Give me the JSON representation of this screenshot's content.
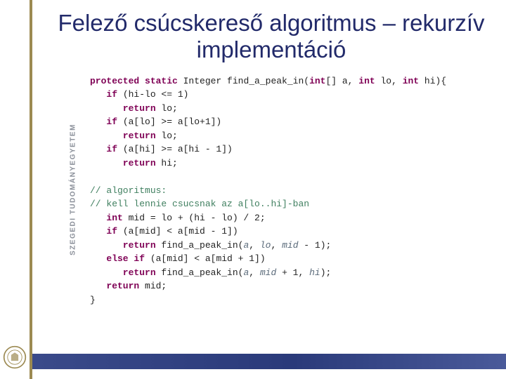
{
  "sidebar": {
    "institution": "SZEGEDI TUDOMÁNYEGYETEM",
    "logo_letters_top": "UNIVERSITAS",
    "logo_letters_bottom": "SCIENTIARUM"
  },
  "title": "Felező csúcskereső algoritmus – rekurzív implementáció",
  "code": {
    "l01a": "protected static ",
    "l01b": "Integer find_a_peak_in(",
    "l01c": "int",
    "l01d": "[] a, ",
    "l01e": "int",
    "l01f": " lo, ",
    "l01g": "int",
    "l01h": " hi){",
    "l02a": "   if ",
    "l02b": "(hi-lo <= 1)",
    "l03a": "      return ",
    "l03b": "lo;",
    "l04a": "   if ",
    "l04b": "(a[lo] >= a[lo+1])",
    "l05a": "      return ",
    "l05b": "lo;",
    "l06a": "   if ",
    "l06b": "(a[hi] >= a[hi - 1])",
    "l07a": "      return ",
    "l07b": "hi;",
    "blank1": "",
    "l08": "// algoritmus:",
    "l09": "// kell lennie csucsnak az a[lo..hi]-ban",
    "l10a": "   int ",
    "l10b": "mid = lo + (hi - lo) / 2;",
    "l11a": "   if ",
    "l11b": "(a[mid] < a[mid - 1])",
    "l12a": "      return ",
    "l12b": "find_a_peak_in(",
    "l12c": "a",
    "l12d": ", ",
    "l12e": "lo",
    "l12f": ", ",
    "l12g": "mid",
    "l12h": " - 1);",
    "l13a": "   else if ",
    "l13b": "(a[mid] < a[mid + 1])",
    "l14a": "      return ",
    "l14b": "find_a_peak_in(",
    "l14c": "a",
    "l14d": ", ",
    "l14e": "mid",
    "l14f": " + 1, ",
    "l14g": "hi",
    "l14h": ");",
    "l15a": "   return ",
    "l15b": "mid;",
    "l16": "}"
  }
}
